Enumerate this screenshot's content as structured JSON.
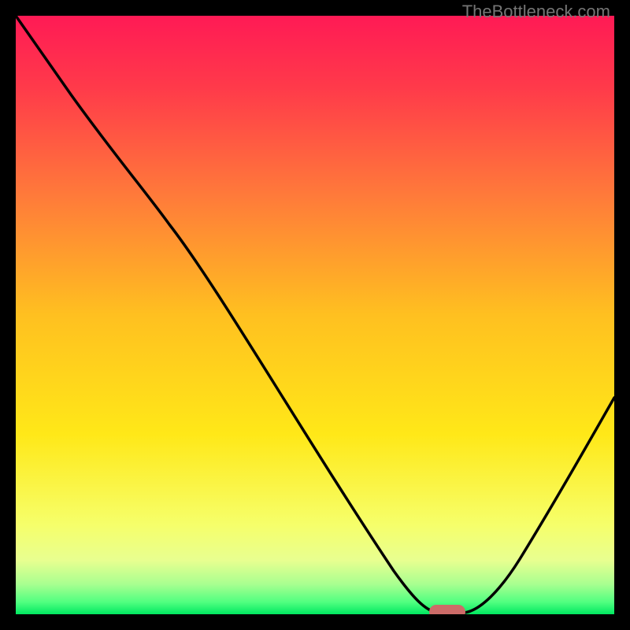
{
  "watermark": "TheBottleneck.com",
  "chart_data": {
    "type": "line",
    "title": "",
    "xlabel": "",
    "ylabel": "",
    "xlim": [
      0,
      100
    ],
    "ylim": [
      0,
      100
    ],
    "x": [
      0,
      5,
      10,
      15,
      20,
      25,
      30,
      35,
      40,
      45,
      50,
      55,
      60,
      65,
      68,
      72,
      75,
      80,
      85,
      90,
      95,
      100
    ],
    "values": [
      100,
      93,
      86,
      79,
      72,
      69,
      62,
      55,
      48,
      41,
      34,
      27,
      20,
      12,
      4,
      0,
      0,
      5,
      13,
      22,
      31,
      40
    ],
    "marker": {
      "x": 71,
      "y": 0
    },
    "gradient_stops": [
      {
        "pos": 0,
        "color": "#ff1654"
      },
      {
        "pos": 50,
        "color": "#ffde00"
      },
      {
        "pos": 85,
        "color": "#f8ff7a"
      },
      {
        "pos": 93,
        "color": "#c8ff8a"
      },
      {
        "pos": 97,
        "color": "#5cff7a"
      },
      {
        "pos": 100,
        "color": "#00e85c"
      }
    ]
  }
}
